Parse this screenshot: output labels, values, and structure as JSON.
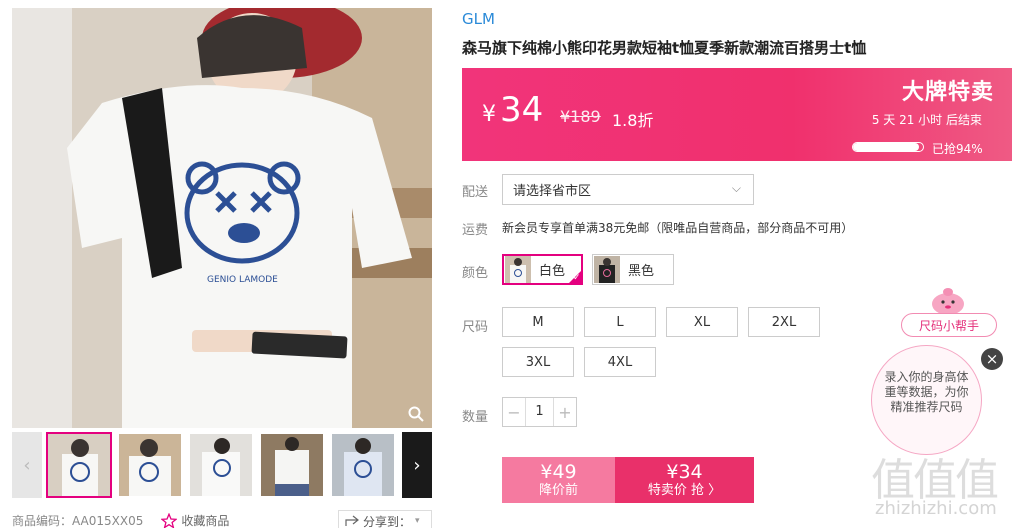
{
  "product": {
    "brand": "GLM",
    "title": "森马旗下纯棉小熊印花男款短袖t恤夏季新款潮流百搭男士t恤",
    "main_image_print_text": "GENIO LAMODE"
  },
  "price_banner": {
    "currency": "¥",
    "price": "34",
    "original_price": "¥189",
    "discount": "1.8折",
    "tag": "大牌特卖",
    "countdown": "5 天 21 小时 后结束",
    "sold_percent": 94,
    "sold_text": "已抢94%"
  },
  "delivery": {
    "label": "配送",
    "placeholder": "请选择省市区"
  },
  "freight": {
    "label": "运费",
    "text": "新会员专享首单满38元免邮（限唯品自营商品，部分商品不可用）"
  },
  "color": {
    "label": "颜色",
    "options": [
      {
        "name": "白色",
        "selected": true
      },
      {
        "name": "黑色",
        "selected": false
      }
    ]
  },
  "size": {
    "label": "尺码",
    "options": [
      "M",
      "L",
      "XL",
      "2XL",
      "3XL",
      "4XL"
    ]
  },
  "quantity": {
    "label": "数量",
    "minus": "−",
    "plus": "+",
    "value": "1"
  },
  "buy": {
    "before_price": "¥49",
    "before_label": "降价前",
    "special_price": "¥34",
    "special_label": "特卖价 抢 〉"
  },
  "meta": {
    "code_label": "商品编码：AA015XX05",
    "favorite_label": "收藏商品",
    "share_label": "分享到："
  },
  "size_helper": {
    "button_label": "尺码小帮手",
    "bubble_text": "录入你的身高体重等数据，为你精准推荐尺码",
    "close": "×"
  },
  "watermark": {
    "glyphs": "值值值",
    "text": "zhizhizhi.com"
  },
  "colors": {
    "accent": "#e4007f",
    "banner": "#f0306d",
    "brand_link": "#2a8ad8"
  }
}
